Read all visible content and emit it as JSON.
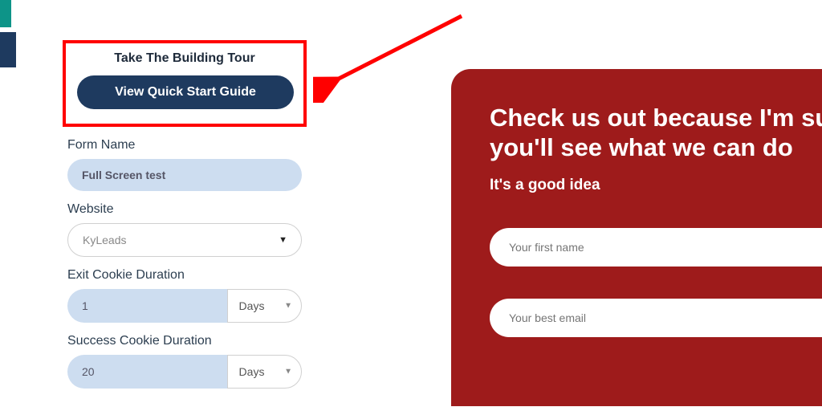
{
  "tour": {
    "title": "Take The Building Tour",
    "button_label": "View Quick Start Guide"
  },
  "fields": {
    "form_name": {
      "label": "Form Name",
      "value": "Full Screen test"
    },
    "website": {
      "label": "Website",
      "value": "KyLeads"
    },
    "exit_cookie": {
      "label": "Exit Cookie Duration",
      "value": "1",
      "unit": "Days"
    },
    "success_cookie": {
      "label": "Success Cookie Duration",
      "value": "20",
      "unit": "Days"
    }
  },
  "preview": {
    "heading": "Check us out because I'm sure you'll see what we can do",
    "subheading": "It's a good idea",
    "firstname_placeholder": "Your first name",
    "email_placeholder": "Your best email"
  },
  "colors": {
    "accent_dark": "#1e3a5f",
    "annotation_red": "#ff0000",
    "preview_bg": "#9e1b1b",
    "pill_blue": "#cdddf0"
  }
}
